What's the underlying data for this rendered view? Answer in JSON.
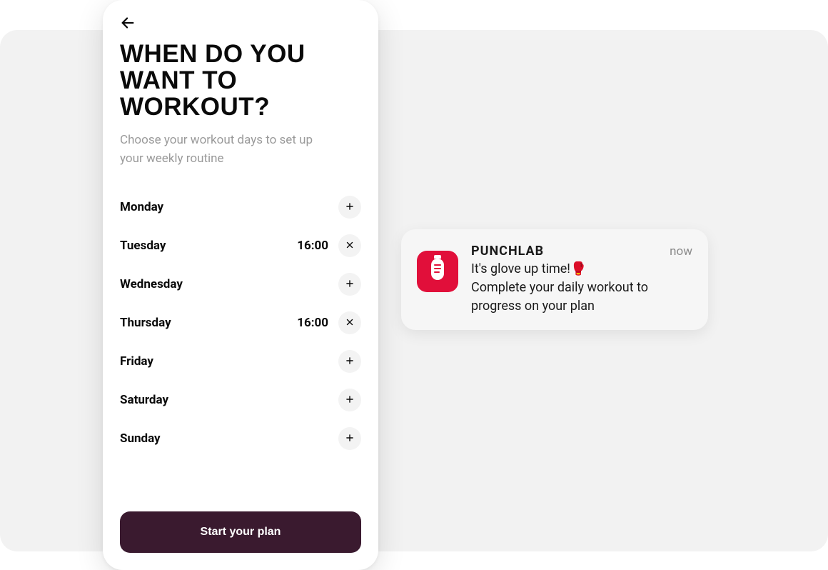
{
  "screen": {
    "title": "WHEN DO YOU WANT TO WORKOUT?",
    "subtitle": "Choose your workout days to set up your weekly routine",
    "cta_label": "Start your plan",
    "days": [
      {
        "label": "Monday",
        "time": "",
        "selected": false
      },
      {
        "label": "Tuesday",
        "time": "16:00",
        "selected": true
      },
      {
        "label": "Wednesday",
        "time": "",
        "selected": false
      },
      {
        "label": "Thursday",
        "time": "16:00",
        "selected": true
      },
      {
        "label": "Friday",
        "time": "",
        "selected": false
      },
      {
        "label": "Saturday",
        "time": "",
        "selected": false
      },
      {
        "label": "Sunday",
        "time": "",
        "selected": false
      }
    ]
  },
  "notification": {
    "app_name": "PUNCHLAB",
    "timestamp": "now",
    "line1": "It's glove up time!",
    "emoji": "🥊",
    "line2": "Complete your daily workout to progress on your plan"
  },
  "colors": {
    "cta_bg": "#3a1a2f",
    "notif_icon_bg": "#e10f3a"
  }
}
